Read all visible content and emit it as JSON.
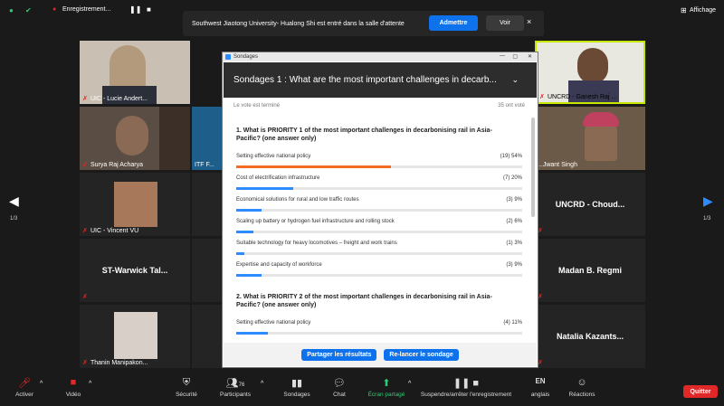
{
  "topbar": {
    "window_title": "Enregistrement...",
    "view_label": "Affichage"
  },
  "notification": {
    "text": "Southwest Jiaotong University- Hualong Shi est entré dans la salle d'attente",
    "admit_label": "Admettre",
    "see_label": "Voir",
    "close_label": "×"
  },
  "participants": [
    {
      "label": "UIC - Lucie Andert..."
    },
    {
      "label": "Surya Raj Acharya"
    },
    {
      "label": "ITF F..."
    },
    {
      "label": "UIC - Vincent VU"
    },
    {
      "label": "ST-Warwick  Tal..."
    },
    {
      "label": "Thanin Manipakon..."
    },
    {
      "label": "UNCRD - Ganesh Raj ..."
    },
    {
      "label": "...Jwant Singh"
    },
    {
      "label": "UNCRD  -  Choud..."
    },
    {
      "label": "Madan B. Regmi"
    },
    {
      "label": "Natalia  Kazants..."
    }
  ],
  "paging": {
    "left": "1/3",
    "right": "1/3"
  },
  "poll": {
    "window_title": "Sondages",
    "header": "Sondages 1 : What are the most important challenges in decarb...",
    "status": "Le vote est terminé",
    "votes": "35 ont voté",
    "questions": [
      {
        "title": "1. What is PRIORITY 1 of the most important challenges in decarbonising rail in Asia-Pacific? (one answer only)",
        "options": [
          {
            "label": "Setting effective national policy",
            "result": "(19) 54%",
            "pct": 54,
            "top": true
          },
          {
            "label": "Cost of electrification infrastructure",
            "result": "(7) 20%",
            "pct": 20
          },
          {
            "label": "Economical solutions for rural and low traffic routes",
            "result": "(3) 9%",
            "pct": 9
          },
          {
            "label": "Scaling up battery or hydrogen fuel infrastructure and rolling stock",
            "result": "(2) 6%",
            "pct": 6
          },
          {
            "label": "Suitable technology for heavy locomotives – freight and work trains",
            "result": "(1) 3%",
            "pct": 3
          },
          {
            "label": "Expertise and capacity of workforce",
            "result": "(3) 9%",
            "pct": 9
          }
        ]
      },
      {
        "title": "2. What is PRIORITY 2 of the most important challenges in decarbonising rail in Asia-Pacific? (one answer only)",
        "options": [
          {
            "label": "Setting effective national policy",
            "result": "(4) 11%",
            "pct": 11
          }
        ]
      }
    ],
    "share_label": "Partager les résultats",
    "relaunch_label": "Re-lancer le sondage"
  },
  "toolbar": {
    "mute": "Activer",
    "video": "Vidéo",
    "security": "Sécurité",
    "participants": "Participants",
    "participants_count": "76",
    "polls": "Sondages",
    "chat": "Chat",
    "share": "Écran partagé",
    "record": "Suspendre/arrêter l'enregistrement",
    "language": "anglais",
    "language_code": "EN",
    "reactions": "Réactions",
    "leave": "Quitter"
  }
}
